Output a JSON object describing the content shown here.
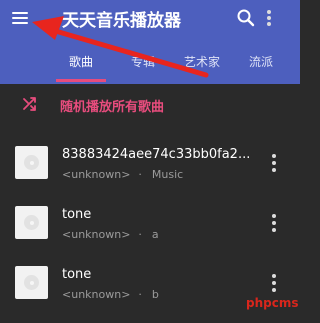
{
  "app": {
    "title": "天天音乐播放器",
    "accent_color": "#e74c7d",
    "header_color": "#4d5fbe"
  },
  "toolbar": {
    "menu_icon": "menu-icon",
    "search_icon": "search-icon",
    "more_icon": "more-vertical-icon"
  },
  "tabs": [
    {
      "label": "歌曲",
      "active": true
    },
    {
      "label": "专辑",
      "active": false
    },
    {
      "label": "艺术家",
      "active": false
    },
    {
      "label": "流派",
      "active": false
    }
  ],
  "shuffle": {
    "label": "随机播放所有歌曲",
    "icon": "shuffle-icon"
  },
  "songs": [
    {
      "title": "83883424aee74c33bb0fa2...",
      "artist": "<unknown>",
      "album": "Music"
    },
    {
      "title": "tone",
      "artist": "<unknown>",
      "album": "a"
    },
    {
      "title": "tone",
      "artist": "<unknown>",
      "album": "b"
    }
  ],
  "separator": "·",
  "watermark": "phpcms"
}
